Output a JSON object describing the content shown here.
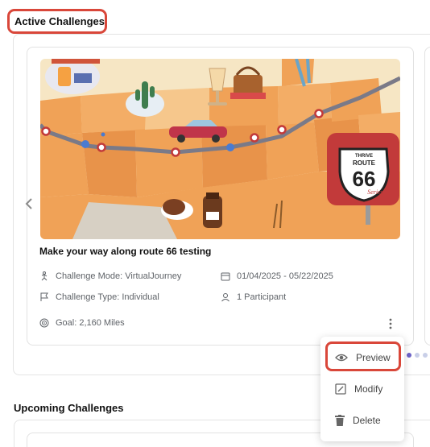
{
  "active_section": {
    "title": "Active Challenges"
  },
  "challenge_card": {
    "title": "Make your way along route 66 testing",
    "mode": "Challenge Mode: VirtualJourney",
    "dates": "01/04/2025 - 05/22/2025",
    "type": "Challenge Type: Individual",
    "participants": "1 Participant",
    "goal": "Goal: 2,160 Miles",
    "sign_top": "THRIVE",
    "sign_route": "ROUTE",
    "sign_number": "66",
    "sign_series": "Series"
  },
  "context_menu": {
    "preview": "Preview",
    "modify": "Modify",
    "delete": "Delete"
  },
  "carousel": {
    "dot_count": 3,
    "active_index": 0
  },
  "upcoming_section": {
    "title": "Upcoming Challenges"
  },
  "colors": {
    "highlight": "#d9473a",
    "accent": "#6d63c9",
    "map_orange": "#f0a257"
  }
}
